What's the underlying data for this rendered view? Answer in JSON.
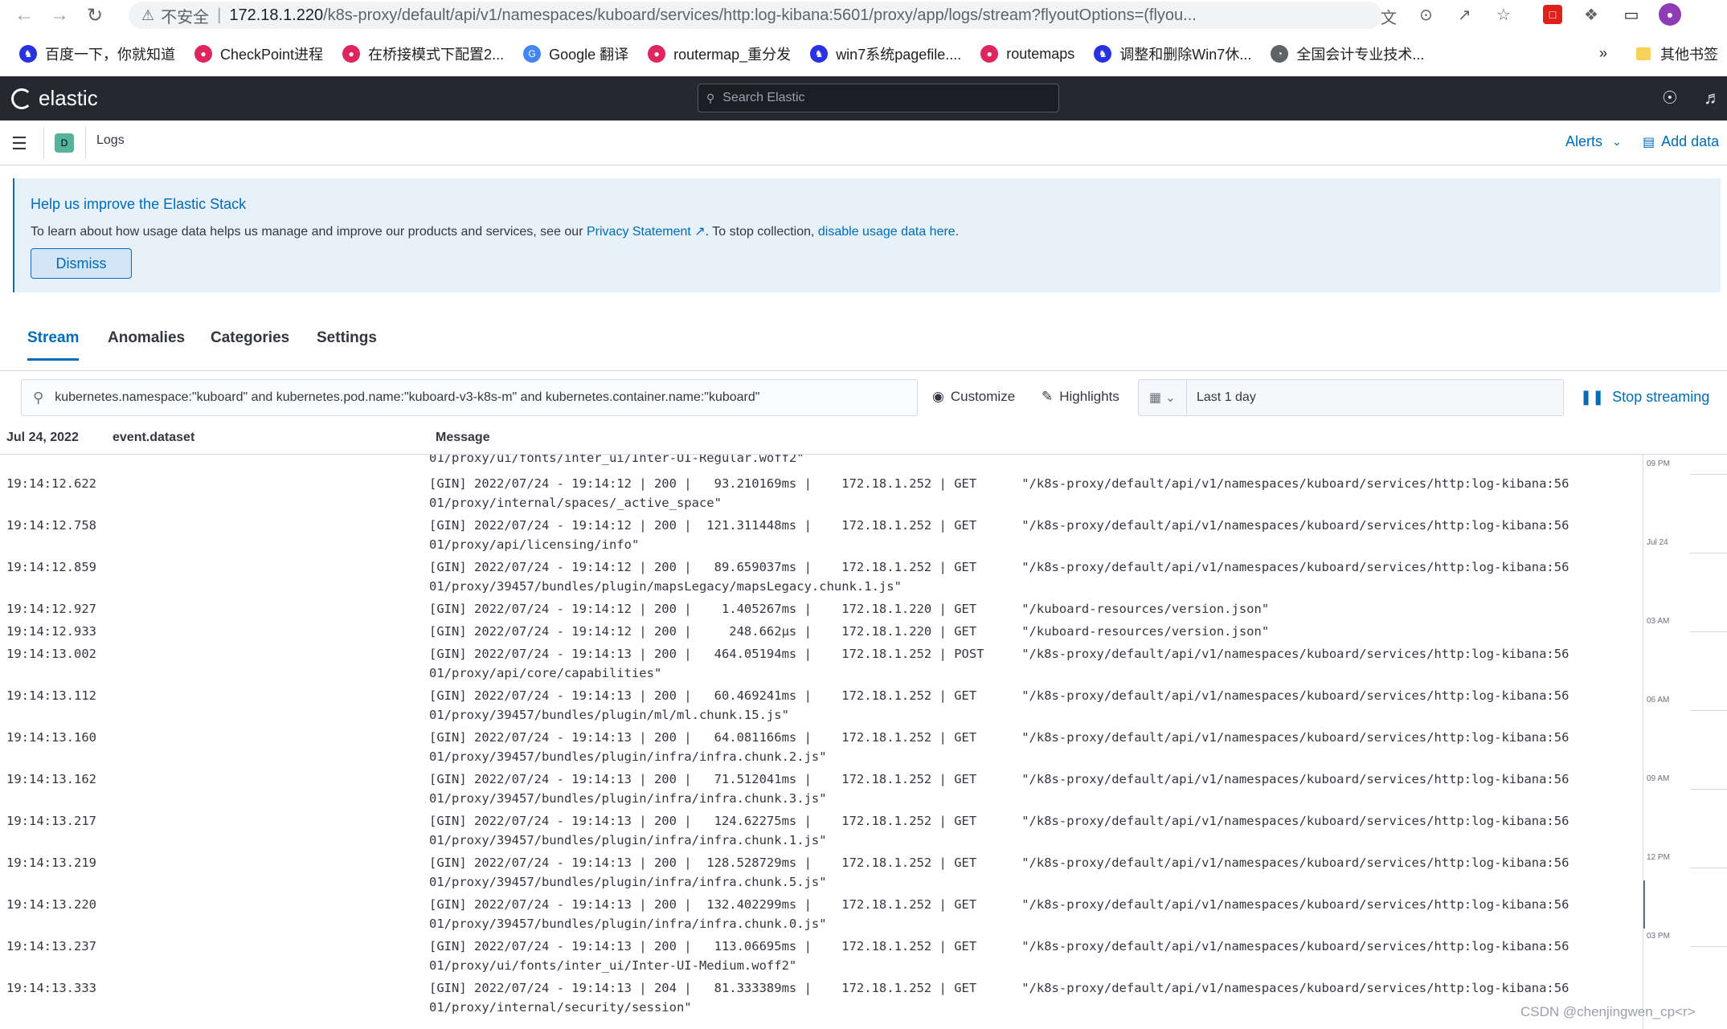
{
  "browser": {
    "insecure_label": "不安全",
    "url_host": "172.18.1.220",
    "url_path": "/k8s-proxy/default/api/v1/namespaces/kuboard/services/http:log-kibana:5601/proxy/app/logs/stream?flyoutOptions=(flyou..."
  },
  "bookmarks": [
    {
      "label": "百度一下，你就知道",
      "color": "#2932e1"
    },
    {
      "label": "CheckPoint进程",
      "color": "#e0245e"
    },
    {
      "label": "在桥接模式下配置2...",
      "color": "#e0245e"
    },
    {
      "label": "Google 翻译",
      "color": "#4285f4"
    },
    {
      "label": "routermap_重分发",
      "color": "#e0245e"
    },
    {
      "label": "win7系统pagefile....",
      "color": "#2932e1"
    },
    {
      "label": "routemaps",
      "color": "#e0245e"
    },
    {
      "label": "调整和删除Win7休...",
      "color": "#2932e1"
    },
    {
      "label": "全国会计专业技术...",
      "color": "#5f6368"
    }
  ],
  "bookmarks_more": "»",
  "bookmarks_other": "其他书签",
  "header": {
    "logo_text": "elastic",
    "search_placeholder": "Search Elastic"
  },
  "subheader": {
    "space_initial": "D",
    "breadcrumb": "Logs",
    "alerts_label": "Alerts",
    "add_data_label": "Add data"
  },
  "callout": {
    "title": "Help us improve the Elastic Stack",
    "body_prefix": "To learn about how usage data helps us manage and improve our products and services, see our ",
    "privacy_link": "Privacy Statement",
    "body_middle": ". To stop collection, ",
    "disable_link": "disable usage data here",
    "body_suffix": ".",
    "dismiss_label": "Dismiss"
  },
  "tabs": [
    {
      "label": "Stream",
      "active": true
    },
    {
      "label": "Anomalies",
      "active": false
    },
    {
      "label": "Categories",
      "active": false
    },
    {
      "label": "Settings",
      "active": false
    }
  ],
  "query": {
    "value": "kubernetes.namespace:\"kuboard\" and kubernetes.pod.name:\"kuboard-v3-k8s-m\" and kubernetes.container.name:\"kuboard\"",
    "customize_label": "Customize",
    "highlights_label": "Highlights",
    "date_range": "Last 1 day",
    "stop_label": "Stop streaming"
  },
  "log_columns": {
    "date": "Jul 24, 2022",
    "dataset": "event.dataset",
    "message": "Message"
  },
  "log_top_fragment": "01/proxy/ui/fonts/inter_ui/Inter-UI-Regular.woff2\"",
  "log_rows": [
    {
      "ts": "19:14:12.622",
      "line1": "[GIN] 2022/07/24 - 19:14:12 | 200 |   93.210169ms |    172.18.1.252 | GET      \"/k8s-proxy/default/api/v1/namespaces/kuboard/services/http:log-kibana:56",
      "line2": "01/proxy/internal/spaces/_active_space\""
    },
    {
      "ts": "19:14:12.758",
      "line1": "[GIN] 2022/07/24 - 19:14:12 | 200 |  121.311448ms |    172.18.1.252 | GET      \"/k8s-proxy/default/api/v1/namespaces/kuboard/services/http:log-kibana:56",
      "line2": "01/proxy/api/licensing/info\""
    },
    {
      "ts": "19:14:12.859",
      "line1": "[GIN] 2022/07/24 - 19:14:12 | 200 |   89.659037ms |    172.18.1.252 | GET      \"/k8s-proxy/default/api/v1/namespaces/kuboard/services/http:log-kibana:56",
      "line2": "01/proxy/39457/bundles/plugin/mapsLegacy/mapsLegacy.chunk.1.js\""
    },
    {
      "ts": "19:14:12.927",
      "line1": "[GIN] 2022/07/24 - 19:14:12 | 200 |    1.405267ms |    172.18.1.220 | GET      \"/kuboard-resources/version.json\"",
      "line2": ""
    },
    {
      "ts": "19:14:12.933",
      "line1": "[GIN] 2022/07/24 - 19:14:12 | 200 |     248.662µs |    172.18.1.220 | GET      \"/kuboard-resources/version.json\"",
      "line2": ""
    },
    {
      "ts": "19:14:13.002",
      "line1": "[GIN] 2022/07/24 - 19:14:13 | 200 |   464.05194ms |    172.18.1.252 | POST     \"/k8s-proxy/default/api/v1/namespaces/kuboard/services/http:log-kibana:56",
      "line2": "01/proxy/api/core/capabilities\""
    },
    {
      "ts": "19:14:13.112",
      "line1": "[GIN] 2022/07/24 - 19:14:13 | 200 |   60.469241ms |    172.18.1.252 | GET      \"/k8s-proxy/default/api/v1/namespaces/kuboard/services/http:log-kibana:56",
      "line2": "01/proxy/39457/bundles/plugin/ml/ml.chunk.15.js\""
    },
    {
      "ts": "19:14:13.160",
      "line1": "[GIN] 2022/07/24 - 19:14:13 | 200 |   64.081166ms |    172.18.1.252 | GET      \"/k8s-proxy/default/api/v1/namespaces/kuboard/services/http:log-kibana:56",
      "line2": "01/proxy/39457/bundles/plugin/infra/infra.chunk.2.js\""
    },
    {
      "ts": "19:14:13.162",
      "line1": "[GIN] 2022/07/24 - 19:14:13 | 200 |   71.512041ms |    172.18.1.252 | GET      \"/k8s-proxy/default/api/v1/namespaces/kuboard/services/http:log-kibana:56",
      "line2": "01/proxy/39457/bundles/plugin/infra/infra.chunk.3.js\""
    },
    {
      "ts": "19:14:13.217",
      "line1": "[GIN] 2022/07/24 - 19:14:13 | 200 |   124.62275ms |    172.18.1.252 | GET      \"/k8s-proxy/default/api/v1/namespaces/kuboard/services/http:log-kibana:56",
      "line2": "01/proxy/39457/bundles/plugin/infra/infra.chunk.1.js\""
    },
    {
      "ts": "19:14:13.219",
      "line1": "[GIN] 2022/07/24 - 19:14:13 | 200 |  128.528729ms |    172.18.1.252 | GET      \"/k8s-proxy/default/api/v1/namespaces/kuboard/services/http:log-kibana:56",
      "line2": "01/proxy/39457/bundles/plugin/infra/infra.chunk.5.js\""
    },
    {
      "ts": "19:14:13.220",
      "line1": "[GIN] 2022/07/24 - 19:14:13 | 200 |  132.402299ms |    172.18.1.252 | GET      \"/k8s-proxy/default/api/v1/namespaces/kuboard/services/http:log-kibana:56",
      "line2": "01/proxy/39457/bundles/plugin/infra/infra.chunk.0.js\""
    },
    {
      "ts": "19:14:13.237",
      "line1": "[GIN] 2022/07/24 - 19:14:13 | 200 |   113.06695ms |    172.18.1.252 | GET      \"/k8s-proxy/default/api/v1/namespaces/kuboard/services/http:log-kibana:56",
      "line2": "01/proxy/ui/fonts/inter_ui/Inter-UI-Medium.woff2\""
    },
    {
      "ts": "19:14:13.333",
      "line1": "[GIN] 2022/07/24 - 19:14:13 | 204 |   81.333389ms |    172.18.1.252 | GET      \"/k8s-proxy/default/api/v1/namespaces/kuboard/services/http:log-kibana:56",
      "line2": "01/proxy/internal/security/session\""
    }
  ],
  "minimap_labels": [
    "09 PM",
    "Jul 24",
    "03 AM",
    "06 AM",
    "09 AM",
    "12 PM",
    "03 PM"
  ],
  "watermark": "CSDN @chenjingwen_cp<r>",
  "colors": {
    "accent": "#006bb8",
    "header_bg": "#25282f",
    "callout_bg": "#e6f1fa",
    "space_avatar": "#54b399"
  }
}
